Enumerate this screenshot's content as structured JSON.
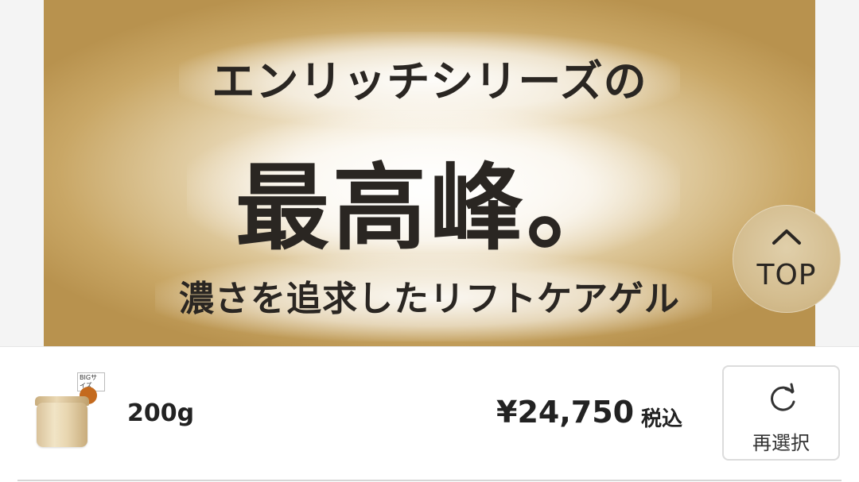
{
  "banner": {
    "line1": "エンリッチシリーズの",
    "line2": "最高峰。",
    "line3": "濃さを追求したリフトケアゲル"
  },
  "top_button": {
    "label": "TOP",
    "icon": "chevron-up-icon"
  },
  "product": {
    "image_tag": "BIGサイズ",
    "size": "200g",
    "price": "¥24,750",
    "tax_label": "税込",
    "reselect_label": "再選択",
    "reselect_icon": "refresh-icon"
  },
  "colors": {
    "banner_gold": "#c9a766",
    "text_dark": "#2a2622",
    "top_button_bg": "#d4bd8f"
  }
}
